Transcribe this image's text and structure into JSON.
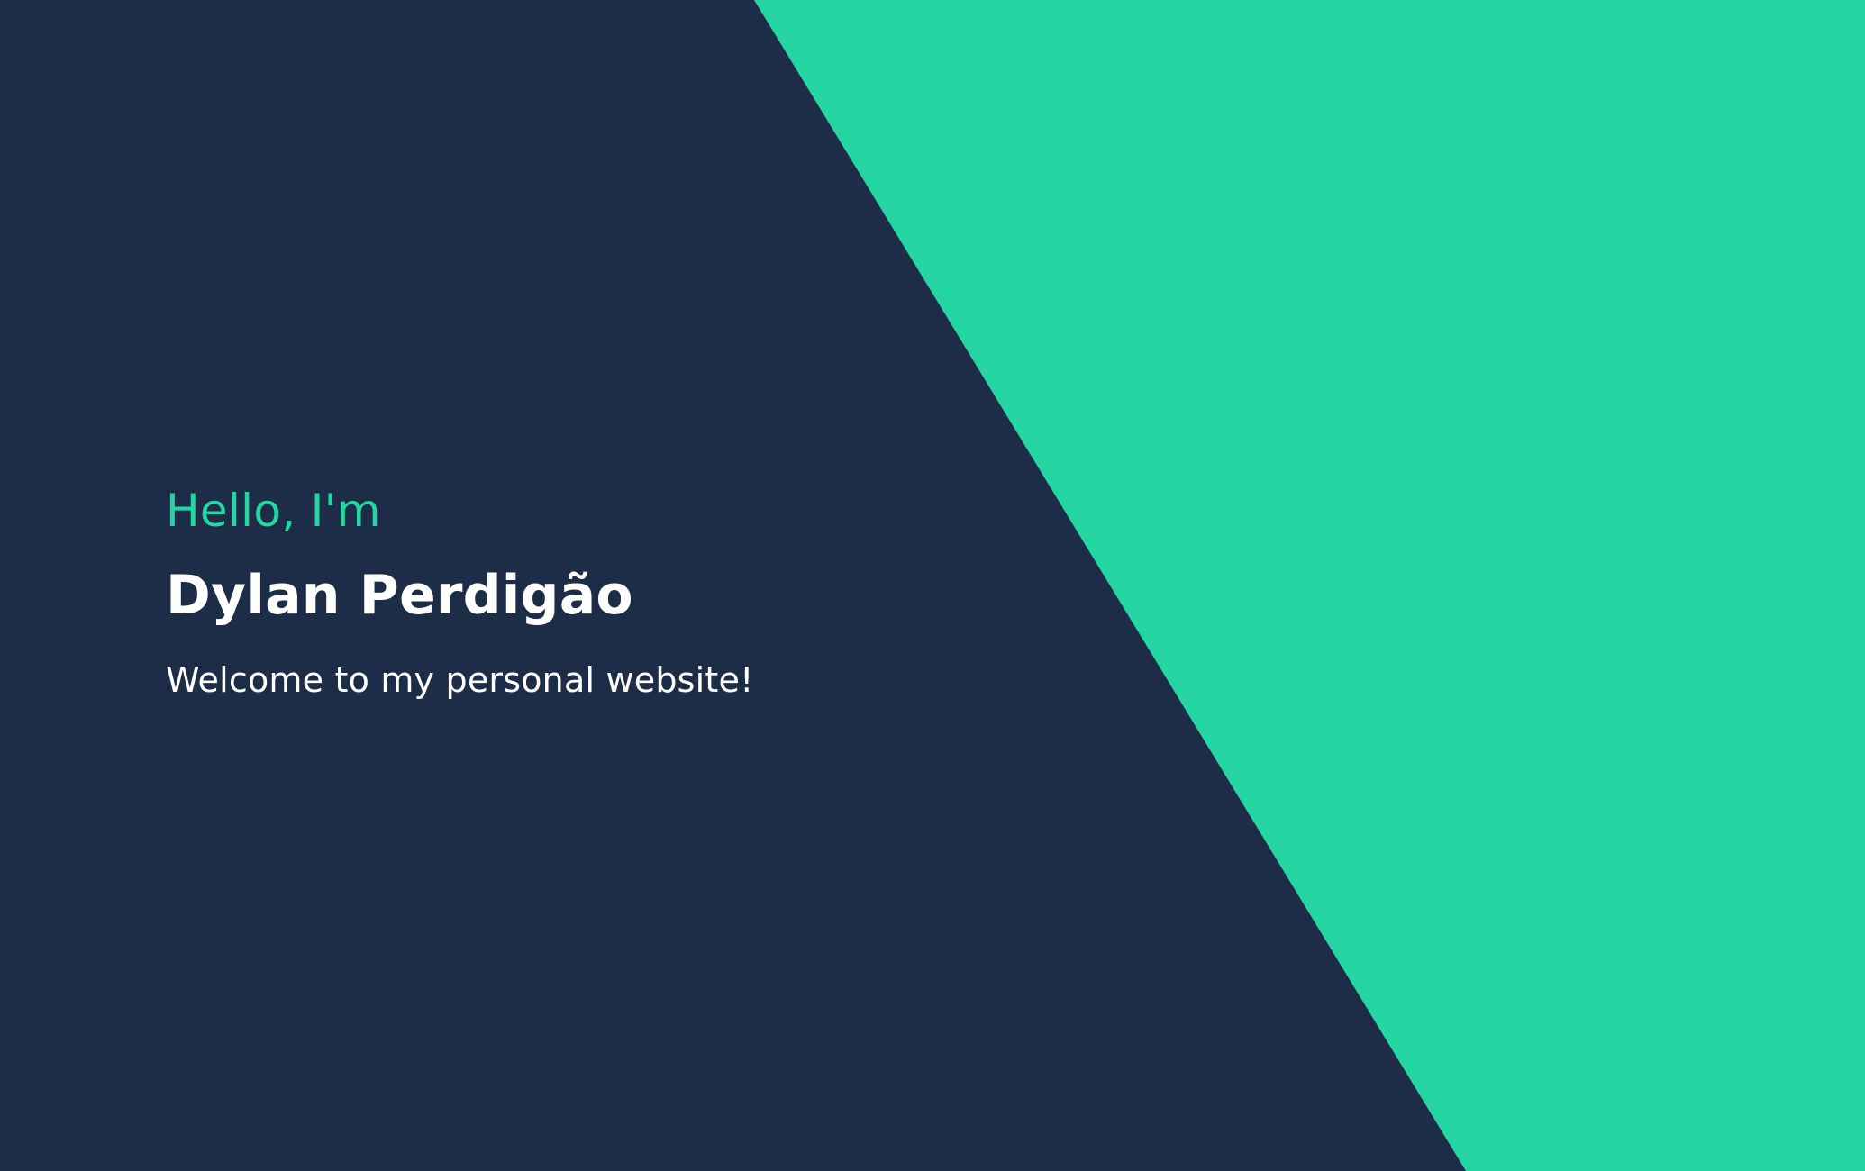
{
  "hero": {
    "greeting": "Hello, I'm",
    "name": "Dylan Perdigão",
    "welcome": "Welcome to my personal website!"
  },
  "colors": {
    "background": "#1d2d47",
    "accent": "#25d6a4",
    "text": "#ffffff"
  }
}
